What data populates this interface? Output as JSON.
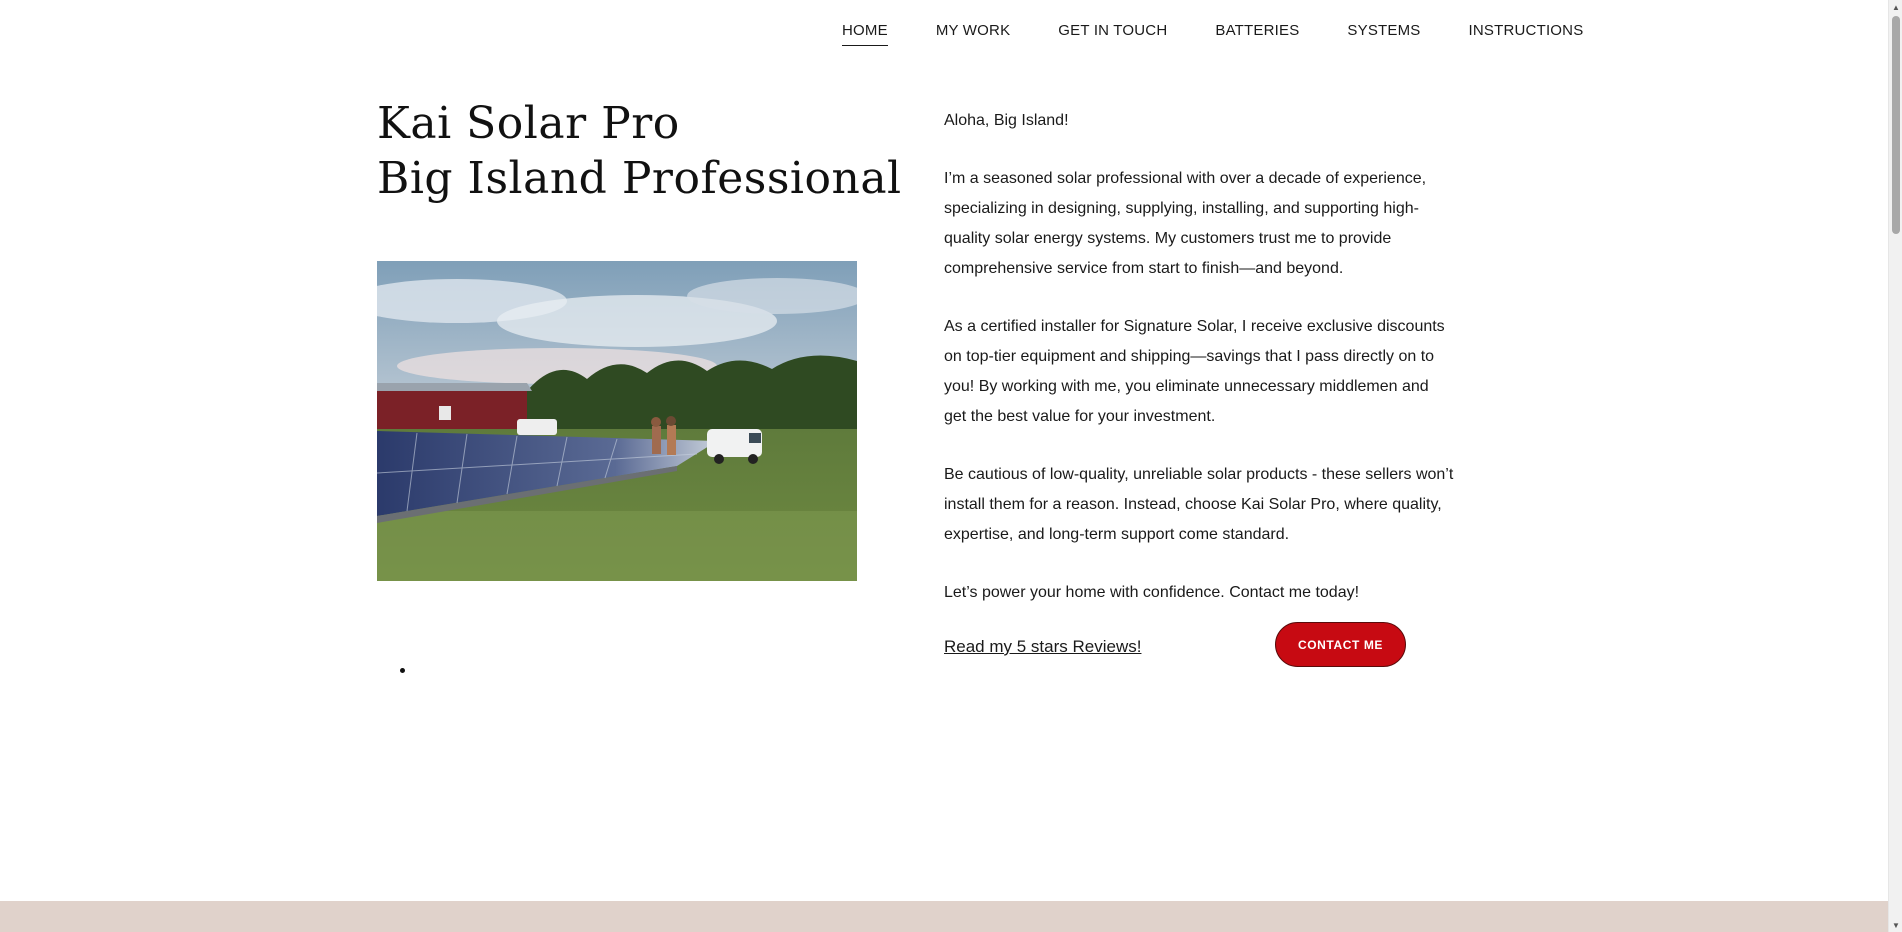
{
  "nav": {
    "items": [
      {
        "label": "HOME",
        "active": true
      },
      {
        "label": "MY WORK"
      },
      {
        "label": "GET IN TOUCH"
      },
      {
        "label": "BATTERIES"
      },
      {
        "label": "SYSTEMS"
      },
      {
        "label": "INSTRUCTIONS"
      }
    ]
  },
  "hero": {
    "title_line1": "Kai Solar Pro",
    "title_line2": "Big Island Professional",
    "photo_icon": "solar-farm-photo"
  },
  "content": {
    "greeting": "Aloha, Big Island!",
    "p1": "I’m a seasoned solar professional with over a decade of experience, specializing in designing, supplying, installing, and supporting high-quality solar energy systems. My customers trust me to provide comprehensive service from start to finish—and beyond.",
    "p2": "As a certified installer for Signature Solar, I receive exclusive discounts on top-tier equipment and shipping—savings that I pass directly on to you! By working with me, you eliminate unnecessary middlemen and get the best value for your investment.",
    "p3": "Be cautious of low-quality, unreliable solar products - these sellers won’t install them for a reason. Instead, choose Kai Solar Pro, where quality, expertise, and long-term support come standard.",
    "p4": "Let’s power your home with confidence. Contact me today!",
    "reviews_link": "Read my 5 stars Reviews!",
    "contact_button": "CONTACT ME"
  },
  "colors": {
    "accent": "#c70a12",
    "footer": "#e0d2cb",
    "text": "#1a1a1a"
  }
}
